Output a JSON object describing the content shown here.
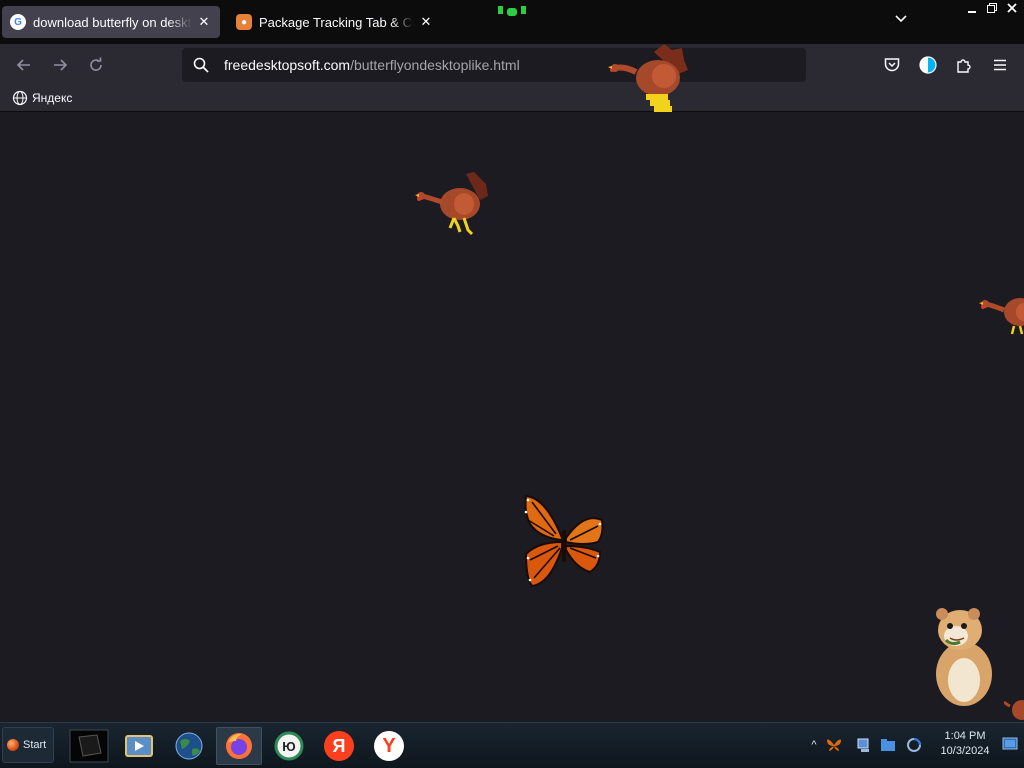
{
  "browser": {
    "tabs": [
      {
        "title": "download butterfly on desktop",
        "favicon": "google-g-icon",
        "active": true
      },
      {
        "title": "Package Tracking Tab & Custo",
        "favicon": "package-tracking-icon",
        "active": false
      }
    ],
    "url": {
      "host": "freedesktopsoft.com",
      "path": "/butterflyondesktoplike.html"
    },
    "bookmarks": [
      {
        "label": "Яндекс",
        "icon": "globe-icon"
      }
    ],
    "toolbar_icons": [
      "pocket-icon",
      "contrast-icon",
      "extensions-icon",
      "menu-icon"
    ],
    "window_controls": [
      "minimize",
      "restore",
      "close"
    ]
  },
  "desktop_sprites": [
    {
      "name": "turkey",
      "icon": "turkey-sprite"
    },
    {
      "name": "turkey",
      "icon": "turkey-sprite"
    },
    {
      "name": "turkey",
      "icon": "turkey-sprite"
    },
    {
      "name": "butterfly",
      "icon": "monarch-butterfly-sprite"
    },
    {
      "name": "hamster",
      "icon": "hamster-sprite"
    }
  ],
  "taskbar": {
    "start_label": "Start",
    "apps": [
      {
        "name": "terminal",
        "icon": "terminal-icon"
      },
      {
        "name": "media-player",
        "icon": "media-player-icon"
      },
      {
        "name": "globe-browser",
        "icon": "earth-icon"
      },
      {
        "name": "firefox",
        "icon": "firefox-icon",
        "active": true
      },
      {
        "name": "yu-browser",
        "icon": "yu-icon",
        "label": "Ю"
      },
      {
        "name": "yandex",
        "icon": "yandex-icon",
        "label": "Я"
      },
      {
        "name": "yandex-browser",
        "icon": "yandex-browser-icon",
        "label": "Y"
      }
    ],
    "tray": {
      "chevron": "^",
      "icons": [
        "butterfly-tray-icon",
        "network-tray-icon",
        "folder-tray-icon",
        "sync-tray-icon"
      ],
      "time": "1:04 PM",
      "date": "10/3/2024"
    }
  },
  "colors": {
    "page_bg": "#1c1b22",
    "toolbar_bg": "#2b2a33",
    "tabstrip_bg": "#0c0c0d",
    "active_tab": "#42414d",
    "taskbar_bg": "#0e161d"
  }
}
